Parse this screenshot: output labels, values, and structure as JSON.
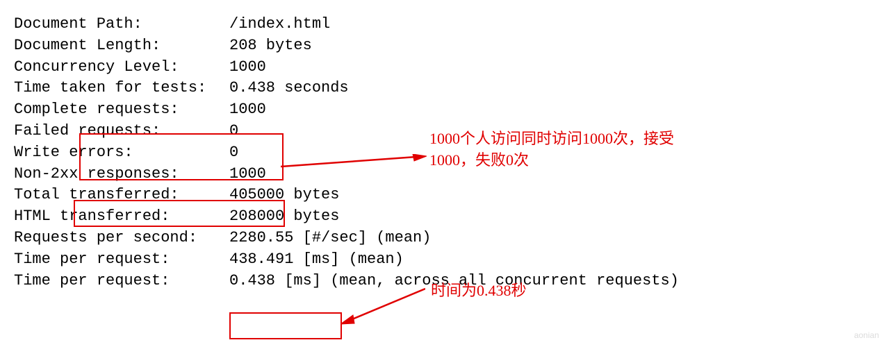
{
  "rows": [
    {
      "label": "Document Path:",
      "value": "/index.html"
    },
    {
      "label": "Document Length:",
      "value": "208 bytes"
    },
    {
      "label": "",
      "value": ""
    },
    {
      "label": "Concurrency Level:",
      "value": "1000"
    },
    {
      "label": "Time taken for tests:",
      "value": "0.438 seconds"
    },
    {
      "label": "Complete requests:",
      "value": "1000"
    },
    {
      "label": "Failed requests:",
      "value": "0"
    },
    {
      "label": "Write errors:",
      "value": "0"
    },
    {
      "label": "Non-2xx responses:",
      "value": "1000"
    },
    {
      "label": "Total transferred:",
      "value": "405000 bytes"
    },
    {
      "label": "HTML transferred:",
      "value": "208000 bytes"
    },
    {
      "label": "Requests per second:",
      "value": "2280.55 [#/sec] (mean)"
    },
    {
      "label": "Time per request:",
      "value": "438.491 [ms] (mean)"
    },
    {
      "label": "Time per request:",
      "value": "0.438 [ms] (mean, across all concurrent requests)"
    }
  ],
  "annotations": {
    "a1": "1000个人访问同时访问1000次，接受1000，失败0次",
    "a2": "时间为0.438秒"
  },
  "watermark": "aonian"
}
